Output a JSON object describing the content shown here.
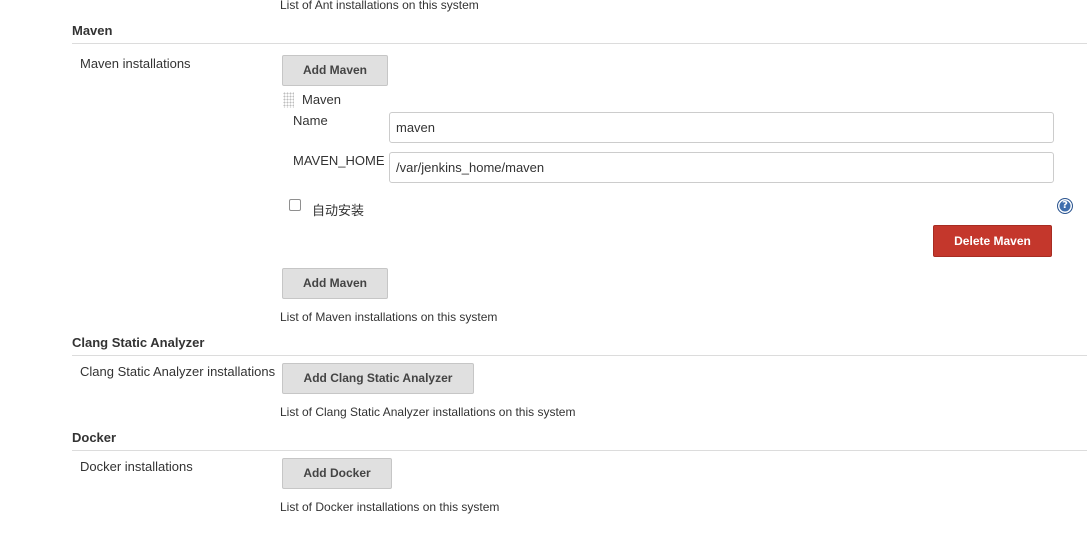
{
  "ant": {
    "hint": "List of Ant installations on this system"
  },
  "maven": {
    "section_title": "Maven",
    "row_label": "Maven installations",
    "add_button_label": "Add Maven",
    "installation": {
      "header": "Maven",
      "name_label": "Name",
      "name_value": "maven",
      "home_label": "MAVEN_HOME",
      "home_value": "/var/jenkins_home/maven",
      "auto_install_label": "自动安装",
      "auto_install_checked": false,
      "help_icon": "question-mark-icon",
      "delete_button_label": "Delete Maven"
    },
    "hint": "List of Maven installations on this system"
  },
  "clang": {
    "section_title": "Clang Static Analyzer",
    "row_label": "Clang Static Analyzer installations",
    "add_button_label": "Add Clang Static Analyzer",
    "hint": "List of Clang Static Analyzer installations on this system"
  },
  "docker": {
    "section_title": "Docker",
    "row_label": "Docker installations",
    "add_button_label": "Add Docker",
    "hint": "List of Docker installations on this system"
  },
  "colors": {
    "danger": "#c4372c",
    "button_bg": "#e0e0e0",
    "help_icon": "#3f6ead"
  }
}
